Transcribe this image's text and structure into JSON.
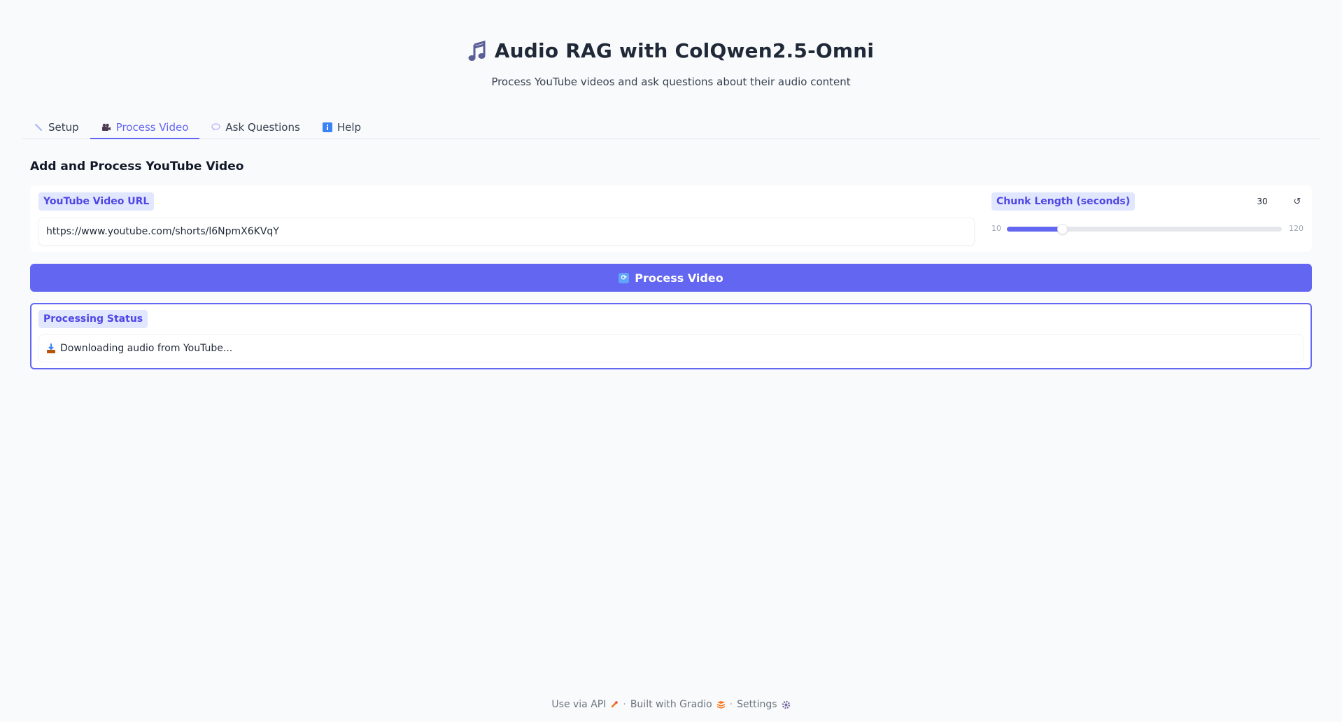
{
  "header": {
    "title": "Audio RAG with ColQwen2.5-Omni",
    "subtitle": "Process YouTube videos and ask questions about their audio content",
    "icon": "music-note-icon"
  },
  "tabs": [
    {
      "label": "Setup",
      "icon": "wrench-icon",
      "active": false
    },
    {
      "label": "Process Video",
      "icon": "video-camera-icon",
      "active": true
    },
    {
      "label": "Ask Questions",
      "icon": "speech-bubble-icon",
      "active": false
    },
    {
      "label": "Help",
      "icon": "info-icon",
      "active": false
    }
  ],
  "section": {
    "title": "Add and Process YouTube Video"
  },
  "url_field": {
    "label": "YouTube Video URL",
    "value": "https://www.youtube.com/shorts/l6NpmX6KVqY"
  },
  "chunk_slider": {
    "label": "Chunk Length (seconds)",
    "value": "30",
    "min": "10",
    "max": "120",
    "fraction": 0.2
  },
  "process_button": {
    "label": "Process Video",
    "icon": "refresh-icon"
  },
  "status": {
    "label": "Processing Status",
    "text": "Downloading audio from YouTube...",
    "icon": "inbox-tray-icon"
  },
  "footer": {
    "api_label": "Use via API",
    "built_label": "Built with Gradio",
    "settings_label": "Settings",
    "separator": "·"
  },
  "colors": {
    "accent": "#6366f1",
    "badge_bg": "#e0e7ff",
    "badge_text": "#4f46e5"
  }
}
